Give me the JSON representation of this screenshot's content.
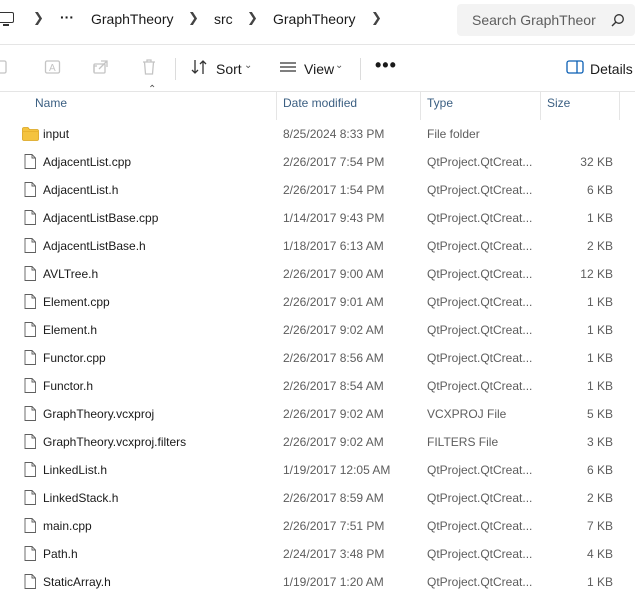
{
  "breadcrumb": {
    "more": "···",
    "items": [
      "GraphTheory",
      "src",
      "GraphTheory"
    ]
  },
  "search": {
    "placeholder": "Search GraphTheor"
  },
  "toolbar": {
    "sort_label": "Sort",
    "view_label": "View",
    "more_label": "•••",
    "details_label": "Details"
  },
  "columns": {
    "name": "Name",
    "date": "Date modified",
    "type": "Type",
    "size": "Size"
  },
  "files": [
    {
      "name": "input",
      "date": "8/25/2024 8:33 PM",
      "type": "File folder",
      "size": "",
      "kind": "folder"
    },
    {
      "name": "AdjacentList.cpp",
      "date": "2/26/2017 7:54 PM",
      "type": "QtProject.QtCreat...",
      "size": "32 KB",
      "kind": "file"
    },
    {
      "name": "AdjacentList.h",
      "date": "2/26/2017 1:54 PM",
      "type": "QtProject.QtCreat...",
      "size": "6 KB",
      "kind": "file"
    },
    {
      "name": "AdjacentListBase.cpp",
      "date": "1/14/2017 9:43 PM",
      "type": "QtProject.QtCreat...",
      "size": "1 KB",
      "kind": "file"
    },
    {
      "name": "AdjacentListBase.h",
      "date": "1/18/2017 6:13 AM",
      "type": "QtProject.QtCreat...",
      "size": "2 KB",
      "kind": "file"
    },
    {
      "name": "AVLTree.h",
      "date": "2/26/2017 9:00 AM",
      "type": "QtProject.QtCreat...",
      "size": "12 KB",
      "kind": "file"
    },
    {
      "name": "Element.cpp",
      "date": "2/26/2017 9:01 AM",
      "type": "QtProject.QtCreat...",
      "size": "1 KB",
      "kind": "file"
    },
    {
      "name": "Element.h",
      "date": "2/26/2017 9:02 AM",
      "type": "QtProject.QtCreat...",
      "size": "1 KB",
      "kind": "file"
    },
    {
      "name": "Functor.cpp",
      "date": "2/26/2017 8:56 AM",
      "type": "QtProject.QtCreat...",
      "size": "1 KB",
      "kind": "file"
    },
    {
      "name": "Functor.h",
      "date": "2/26/2017 8:54 AM",
      "type": "QtProject.QtCreat...",
      "size": "1 KB",
      "kind": "file"
    },
    {
      "name": "GraphTheory.vcxproj",
      "date": "2/26/2017 9:02 AM",
      "type": "VCXPROJ File",
      "size": "5 KB",
      "kind": "file"
    },
    {
      "name": "GraphTheory.vcxproj.filters",
      "date": "2/26/2017 9:02 AM",
      "type": "FILTERS File",
      "size": "3 KB",
      "kind": "file"
    },
    {
      "name": "LinkedList.h",
      "date": "1/19/2017 12:05 AM",
      "type": "QtProject.QtCreat...",
      "size": "6 KB",
      "kind": "file"
    },
    {
      "name": "LinkedStack.h",
      "date": "2/26/2017 8:59 AM",
      "type": "QtProject.QtCreat...",
      "size": "2 KB",
      "kind": "file"
    },
    {
      "name": "main.cpp",
      "date": "2/26/2017 7:51 PM",
      "type": "QtProject.QtCreat...",
      "size": "7 KB",
      "kind": "file"
    },
    {
      "name": "Path.h",
      "date": "2/24/2017 3:48 PM",
      "type": "QtProject.QtCreat...",
      "size": "4 KB",
      "kind": "file"
    },
    {
      "name": "StaticArray.h",
      "date": "1/19/2017 1:20 AM",
      "type": "QtProject.QtCreat...",
      "size": "1 KB",
      "kind": "file"
    }
  ]
}
